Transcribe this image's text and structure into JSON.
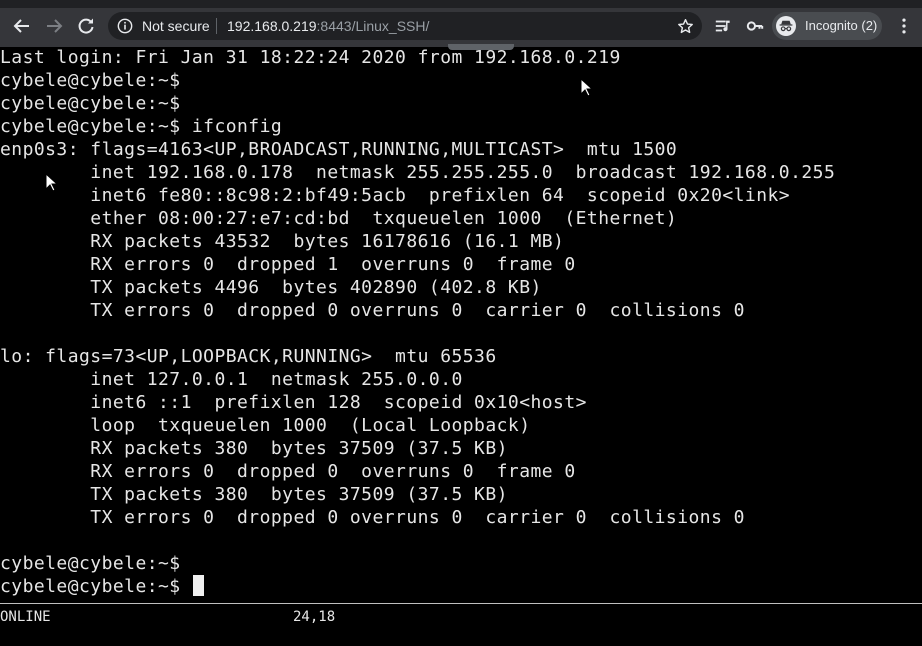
{
  "browser": {
    "security_label": "Not secure",
    "url_host": "192.168.0.219",
    "url_rest": ":8443/Linux_SSH/",
    "incognito_label": "Incognito (2)",
    "accent": "#35363a"
  },
  "terminal": {
    "lines": [
      "Last login: Fri Jan 31 18:22:24 2020 from 192.168.0.219",
      "cybele@cybele:~$",
      "cybele@cybele:~$",
      "cybele@cybele:~$ ifconfig",
      "enp0s3: flags=4163<UP,BROADCAST,RUNNING,MULTICAST>  mtu 1500",
      "        inet 192.168.0.178  netmask 255.255.255.0  broadcast 192.168.0.255",
      "        inet6 fe80::8c98:2:bf49:5acb  prefixlen 64  scopeid 0x20<link>",
      "        ether 08:00:27:e7:cd:bd  txqueuelen 1000  (Ethernet)",
      "        RX packets 43532  bytes 16178616 (16.1 MB)",
      "        RX errors 0  dropped 1  overruns 0  frame 0",
      "        TX packets 4496  bytes 402890 (402.8 KB)",
      "        TX errors 0  dropped 0 overruns 0  carrier 0  collisions 0",
      "",
      "lo: flags=73<UP,LOOPBACK,RUNNING>  mtu 65536",
      "        inet 127.0.0.1  netmask 255.0.0.0",
      "        inet6 ::1  prefixlen 128  scopeid 0x10<host>",
      "        loop  txqueuelen 1000  (Local Loopback)",
      "        RX packets 380  bytes 37509 (37.5 KB)",
      "        RX errors 0  dropped 0  overruns 0  frame 0",
      "        TX packets 380  bytes 37509 (37.5 KB)",
      "        TX errors 0  dropped 0 overruns 0  carrier 0  collisions 0",
      "",
      "cybele@cybele:~$",
      "cybele@cybele:~$ "
    ]
  },
  "status": {
    "mode": "ONLINE",
    "position": "24,18"
  }
}
